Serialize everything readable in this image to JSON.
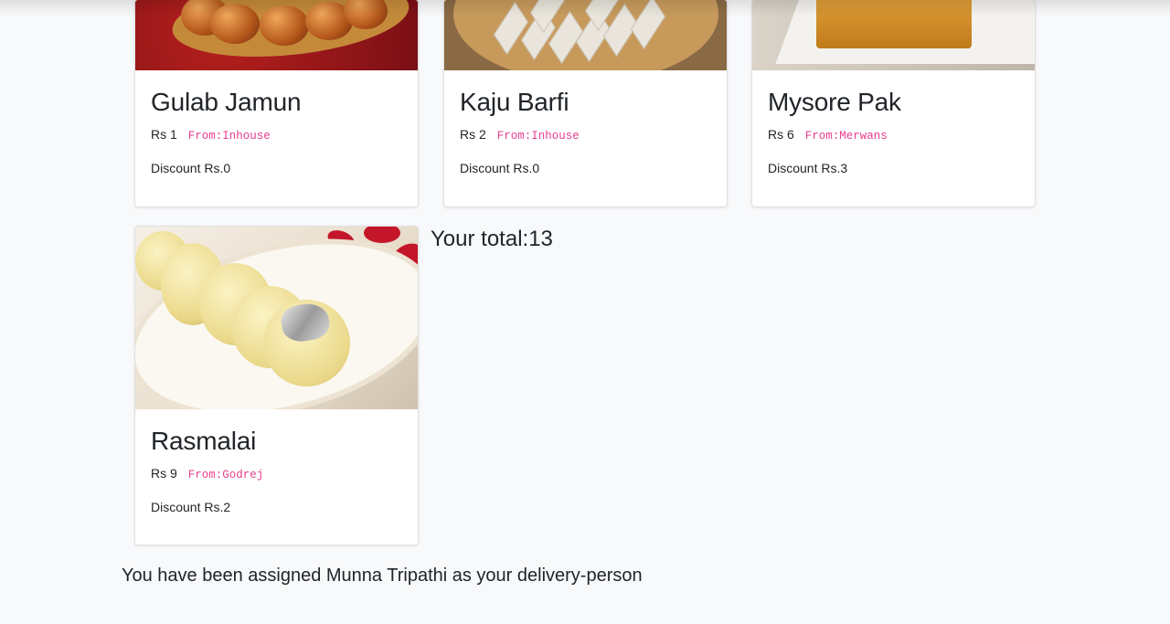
{
  "products": [
    {
      "name": "Gulab Jamun",
      "price": "Rs 1",
      "vendor": "From:Inhouse",
      "discount": "Discount Rs.0",
      "image_icon": "gulab-jamun-photo"
    },
    {
      "name": "Kaju Barfi",
      "price": "Rs 2",
      "vendor": "From:Inhouse",
      "discount": "Discount Rs.0",
      "image_icon": "kaju-barfi-photo"
    },
    {
      "name": "Mysore Pak",
      "price": "Rs 6",
      "vendor": "From:Merwans",
      "discount": "Discount Rs.3",
      "image_icon": "mysore-pak-photo"
    },
    {
      "name": "Rasmalai",
      "price": "Rs 9",
      "vendor": "From:Godrej",
      "discount": "Discount Rs.2",
      "image_icon": "rasmalai-photo"
    }
  ],
  "total_text": "Your total:13",
  "assignment_text": "You have been assigned Munna Tripathi as your delivery-person",
  "colors": {
    "background": "#f8f9fa",
    "vendor_code": "#e83e8c",
    "text": "#212529"
  }
}
